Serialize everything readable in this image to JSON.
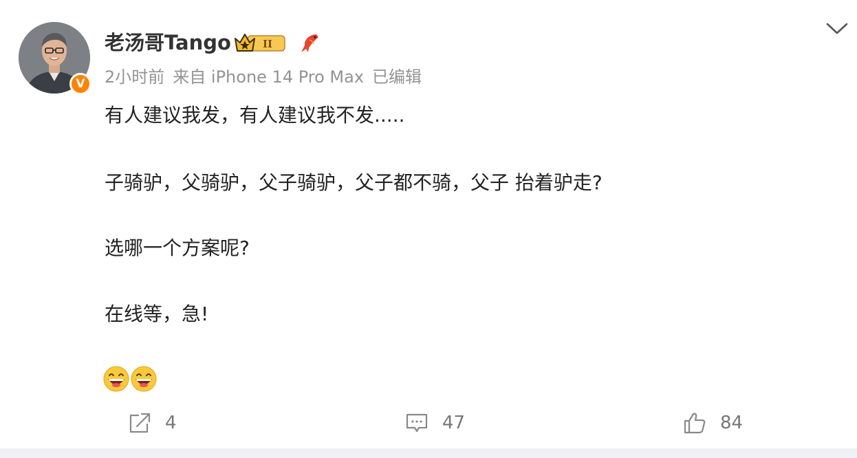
{
  "post": {
    "username": "老汤哥Tango",
    "meta": {
      "time": "2小时前",
      "source": "来自 iPhone 14 Pro Max",
      "edited": "已编辑"
    },
    "lines": [
      "有人建议我发，有人建议我不发.....",
      "子骑驴，父骑驴，父子骑驴，父子都不骑，父子 抬着驴走?",
      "选哪一个方案呢?",
      "在线等，急!"
    ],
    "emojis": [
      "laughing-face",
      "laughing-face"
    ],
    "badges": {
      "verified_mark": "V",
      "level_badge": "II"
    },
    "actions": {
      "repost_count": "4",
      "comment_count": "47",
      "like_count": "84"
    }
  },
  "colors": {
    "verified": "#ff8200",
    "meta_text": "#939393",
    "action_text": "#777777",
    "body_text": "#222222"
  }
}
